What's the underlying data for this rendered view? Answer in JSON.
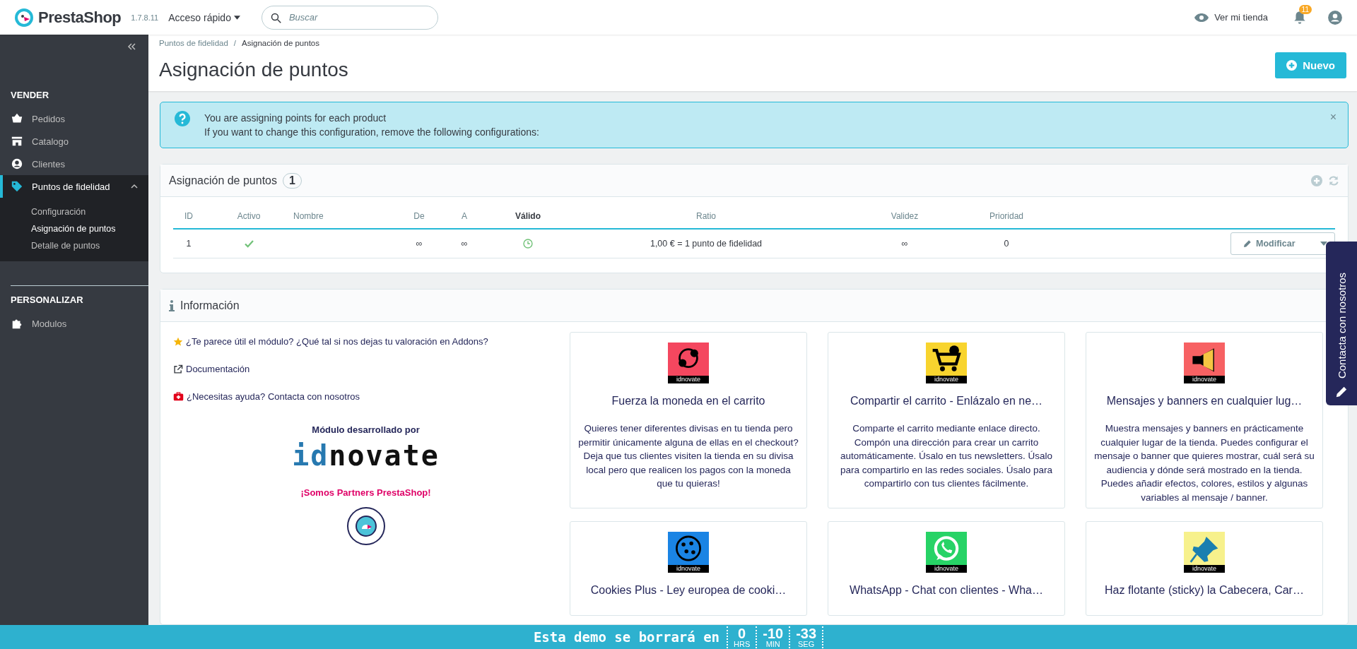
{
  "topbar": {
    "logo": "PrestaShop",
    "version": "1.7.8.11",
    "quick_access": "Acceso rápido",
    "search": {
      "placeholder": "Buscar"
    },
    "view_store": "Ver mi tienda",
    "notifications": "11"
  },
  "sidebar": {
    "sections": [
      {
        "title": "VENDER",
        "items": [
          {
            "label": "Pedidos",
            "selected": false
          },
          {
            "label": "Catalogo",
            "selected": false
          },
          {
            "label": "Clientes",
            "selected": false
          },
          {
            "label": "Puntos de fidelidad",
            "selected": true,
            "expanded": true,
            "children": [
              {
                "label": "Configuración",
                "selected": false
              },
              {
                "label": "Asignación de puntos",
                "selected": true
              },
              {
                "label": "Detalle de puntos",
                "selected": false
              }
            ]
          }
        ]
      },
      {
        "title": "PERSONALIZAR",
        "items": [
          {
            "label": "Modulos",
            "selected": false
          }
        ]
      }
    ]
  },
  "breadcrumb": {
    "items": [
      "Puntos de fidelidad",
      "Asignación de puntos"
    ],
    "separator": "/"
  },
  "page_title": "Asignación de puntos",
  "new_button": "Nuevo",
  "alert": {
    "lines": [
      "You are assigning points for each product",
      "If you want to change this configuration, remove the following configurations:"
    ],
    "close": "×"
  },
  "table_panel": {
    "title": "Asignación de puntos",
    "count": "1",
    "columns": [
      {
        "label": "ID",
        "sorted": false
      },
      {
        "label": "Activo",
        "sorted": false
      },
      {
        "label": "Nombre",
        "sorted": false
      },
      {
        "label": "De",
        "sorted": false
      },
      {
        "label": "A",
        "sorted": false
      },
      {
        "label": "Válido",
        "sorted": true
      },
      {
        "label": "Ratio",
        "sorted": false
      },
      {
        "label": "Validez",
        "sorted": false
      },
      {
        "label": "Prioridad",
        "sorted": false
      }
    ],
    "rows": [
      {
        "id": "1",
        "active": true,
        "from": "∞",
        "to": "∞",
        "valid": true,
        "ratio": "1,00 € = 1 punto de fidelidad",
        "validity": "∞",
        "priority": "0",
        "action": "Modificar"
      }
    ]
  },
  "info_panel": {
    "title": "Información",
    "links": [
      {
        "kind": "rating",
        "text": "¿Te parece útil el módulo? ¿Qué tal si nos dejas tu valoración en Addons?"
      },
      {
        "kind": "docs",
        "text": "Documentación"
      },
      {
        "kind": "help",
        "text": "¿Necesitas ayuda? Contacta con nosotros"
      }
    ],
    "developed_by": "Módulo desarrollado por",
    "brand": {
      "prefix": "id",
      "rest": "novate"
    },
    "partners": "¡Somos Partners PrestaShop!",
    "cards": [
      {
        "kind": "currency",
        "color": "#f4475f",
        "brand": "idnovate",
        "title": "Fuerza la moneda en el carrito",
        "description": "Quieres tener diferentes divisas en tu tienda pero permitir únicamente alguna de ellas en el checkout? Deja que tus clientes visiten la tienda en su divisa local pero que realicen los pagos con la moneda que tu quieras!"
      },
      {
        "kind": "cart",
        "color": "#f8d42e",
        "brand": "idnovate",
        "title": "Compartir el carrito - Enlázalo en ne…",
        "description": "Comparte el carrito mediante enlace directo. Compón una dirección para crear un carrito automáticamente. Úsalo en tus newsletters. Úsalo para compartirlo en las redes sociales. Úsalo para compartirlo con tus clientes fácilmente."
      },
      {
        "kind": "megaphone",
        "color": "#f76163",
        "brand": "idnovate",
        "title": "Mensajes y banners en cualquier lug…",
        "description": "Muestra mensajes y banners en prácticamente cualquier lugar de la tienda. Puedes configurar el mensaje o banner que quieres mostrar, cuál será su audiencia y dónde será mostrado en la tienda. Puedes añadir efectos, colores, estilos y algunas variables al mensaje / banner."
      },
      {
        "kind": "cookie",
        "color": "#1a84e4",
        "brand": "idnovate",
        "title": "Cookies Plus - Ley europea de cooki…"
      },
      {
        "kind": "chat",
        "color": "#27d366",
        "brand": "idnovate",
        "title": "WhatsApp - Chat con clientes - Wha…"
      },
      {
        "kind": "pin",
        "color": "#f7f18c",
        "brand": "idnovate",
        "title": "Haz flotante (sticky) la Cabecera, Car…"
      }
    ]
  },
  "contact_tab": "Contacta con nosotros",
  "countdown": {
    "label": "Esta demo se borrará en",
    "units": [
      {
        "value": "0",
        "unit": "HRS"
      },
      {
        "value": "-10",
        "unit": "MIN"
      },
      {
        "value": "-33",
        "unit": "SEG"
      }
    ]
  }
}
